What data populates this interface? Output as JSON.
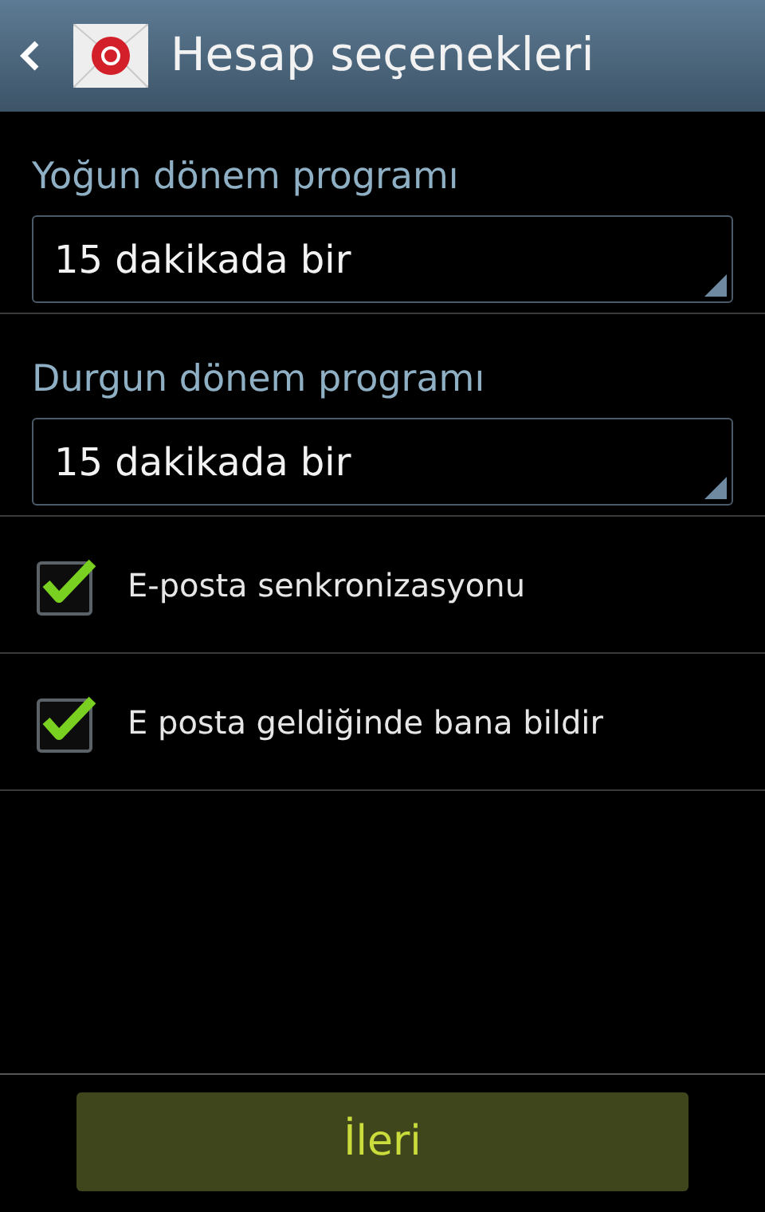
{
  "header": {
    "title": "Hesap seçenekleri"
  },
  "schedules": [
    {
      "label": "Yoğun dönem programı",
      "value": "15 dakikada bir"
    },
    {
      "label": "Durgun dönem programı",
      "value": "15 dakikada bir"
    }
  ],
  "options": [
    {
      "label": "E-posta senkronizasyonu",
      "checked": true
    },
    {
      "label": "E posta geldiğinde bana bildir",
      "checked": true
    }
  ],
  "next_button": "İleri"
}
